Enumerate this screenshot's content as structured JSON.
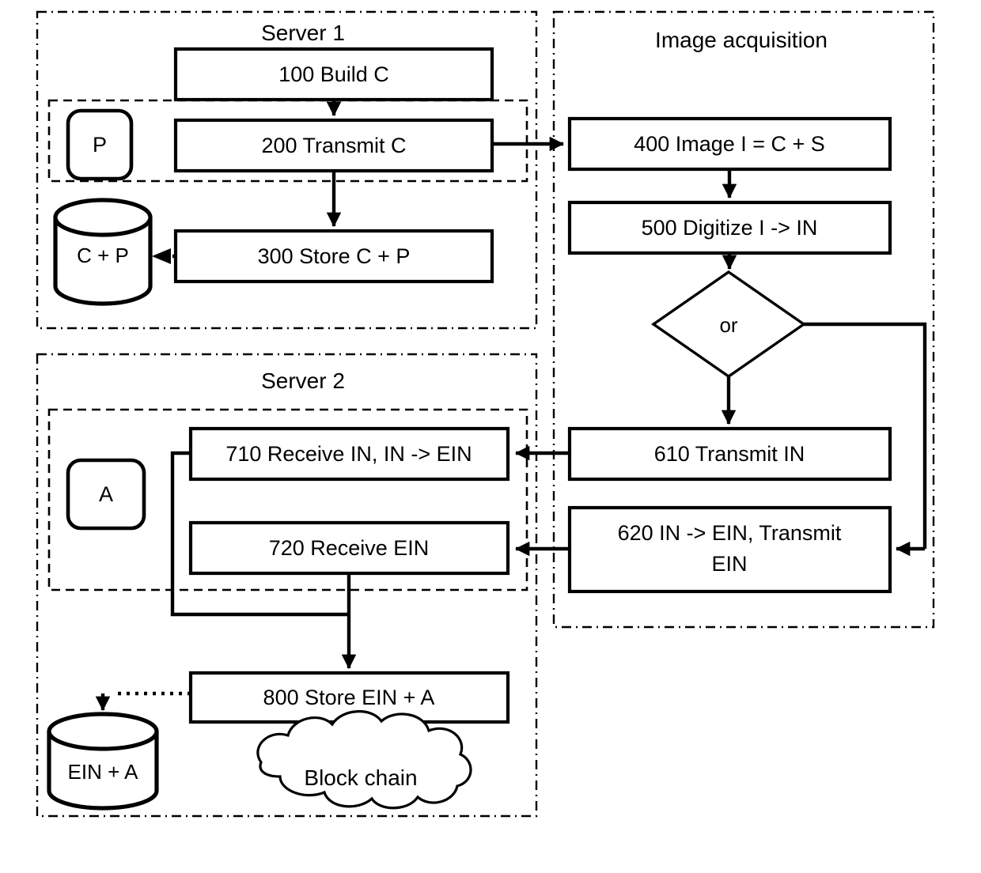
{
  "diagram": {
    "title_groups": {
      "server1": "Server 1",
      "server2": "Server 2",
      "image_acquisition": "Image acquisition"
    },
    "server1": {
      "label": "Server 1",
      "actor": "P",
      "datastore": "C + P",
      "steps": [
        {
          "id": "100",
          "label": "100 Build C"
        },
        {
          "id": "200",
          "label": "200 Transmit C"
        },
        {
          "id": "300",
          "label": "300 Store C + P"
        }
      ]
    },
    "image_acquisition": {
      "label": "Image acquisition",
      "decision": "or",
      "steps": [
        {
          "id": "400",
          "label": "400 Image I = C + S"
        },
        {
          "id": "500",
          "label": "500 Digitize I -> IN"
        },
        {
          "id": "610",
          "label": "610 Transmit IN"
        },
        {
          "id": "620",
          "label": "620 IN -> EIN, Transmit EIN"
        }
      ],
      "step_620_line1": "620 IN -> EIN, Transmit",
      "step_620_line2": "EIN"
    },
    "server2": {
      "label": "Server 2",
      "actor": "A",
      "datastore": "EIN + A",
      "cloud": "Block chain",
      "steps": [
        {
          "id": "710",
          "label": "710 Receive IN, IN -> EIN"
        },
        {
          "id": "720",
          "label": "720 Receive EIN"
        },
        {
          "id": "800",
          "label": "800 Store EIN + A"
        }
      ]
    },
    "colors": {
      "stroke": "#000000",
      "fill": "#ffffff"
    }
  }
}
